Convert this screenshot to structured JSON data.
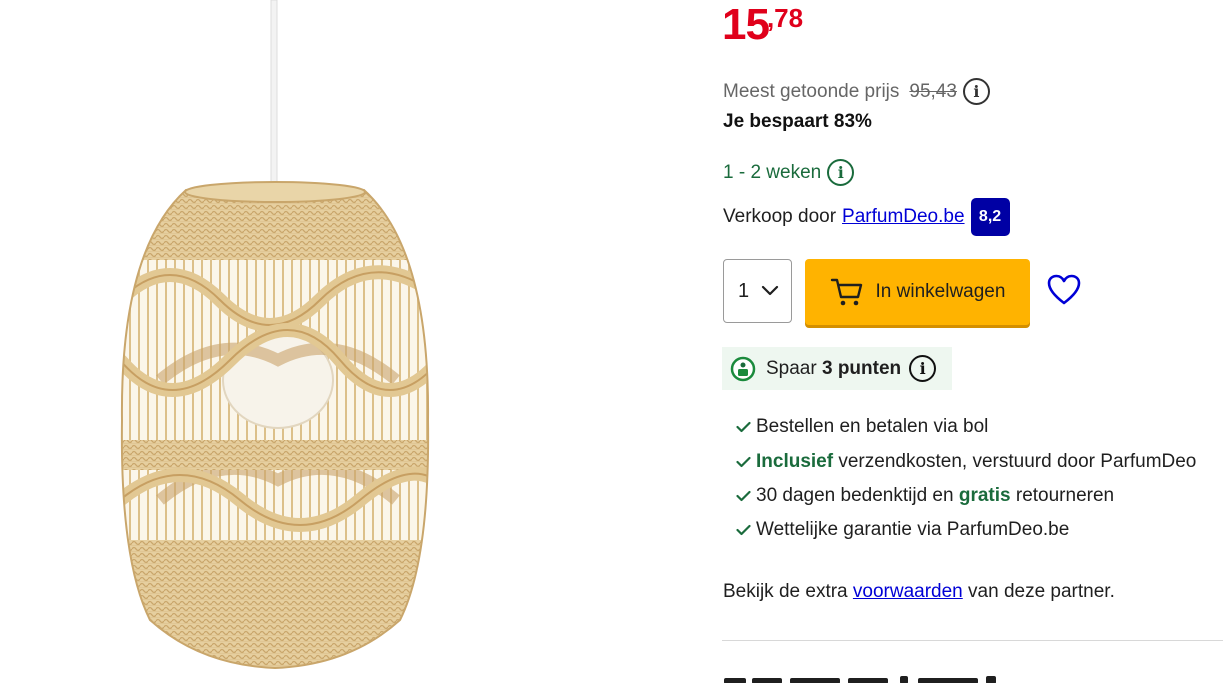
{
  "product": {
    "image_alt": "rattan hanglamp"
  },
  "price": {
    "euros": "15",
    "cents": ",78"
  },
  "reference_price": {
    "label": "Meest getoonde prijs",
    "value": "95,43",
    "info_icon": "i"
  },
  "savings": {
    "text": "Je bespaart 83%"
  },
  "delivery": {
    "text": "1 - 2 weken",
    "info_icon": "i"
  },
  "seller": {
    "prefix": "Verkoop door",
    "name": "ParfumDeo.be",
    "rating": "8,2"
  },
  "quantity": {
    "value": "1"
  },
  "cart_button": {
    "label": "In winkelwagen"
  },
  "points": {
    "prefix": "Spaar",
    "bold": "3 punten",
    "info_icon": "i"
  },
  "usps": [
    {
      "plain": "Bestellen en betalen via bol"
    },
    {
      "bold": "Inclusief",
      "plain": " verzendkosten, verstuurd door ParfumDeo"
    },
    {
      "plain": "30 dagen bedenktijd en ",
      "bold": "gratis",
      "after": " retourneren"
    },
    {
      "plain": "Wettelijke garantie via ParfumDeo.be"
    }
  ],
  "terms": {
    "prefix": "Bekijk de extra",
    "link": "voorwaarden",
    "suffix": "van deze partner."
  },
  "colors": {
    "price_red": "#e0001b",
    "cart_yellow": "#ffb300",
    "link_blue": "#0000d6",
    "rating_badge": "#0000a4",
    "green": "#1a6b3c"
  }
}
